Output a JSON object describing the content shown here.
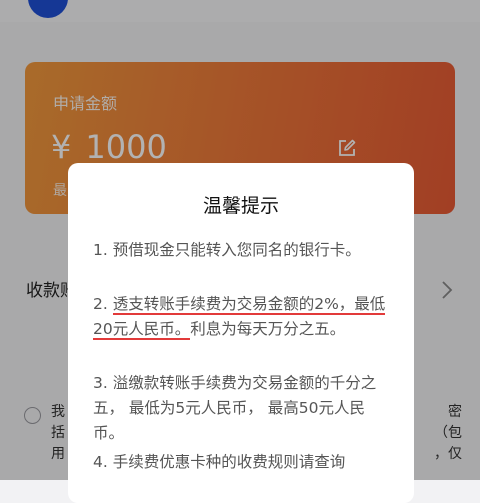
{
  "background": {
    "card": {
      "label": "申请金额",
      "currency": "¥",
      "amount": "1000",
      "edit_icon": "edit-icon",
      "partial_text": "最"
    },
    "payee_row": {
      "label": "收款账",
      "chevron": "chevron-right-icon"
    },
    "agreement": {
      "left_lines": [
        "我",
        "括",
        "用"
      ],
      "right_lines": [
        "密（包",
        "，仅"
      ]
    }
  },
  "dialog": {
    "title": "温馨提示",
    "tips": [
      {
        "prefix": "1. ",
        "text": "预借现金只能转入您同名的银行卡。"
      },
      {
        "prefix": "2. ",
        "highlight": "透支转账手续费为交易金额的2%，最低20元人民币。",
        "rest": "利息为每天万分之五。"
      },
      {
        "prefix": "3. ",
        "text": "溢缴款转账手续费为交易金额的千分之五， 最低为5元人民币， 最高50元人民币。"
      },
      {
        "prefix": "4. ",
        "text": "手续费优惠卡种的收费规则请查询"
      }
    ]
  },
  "colors": {
    "card_gradient_start": "#f29a3d",
    "card_gradient_end": "#e85a34",
    "underline": "#e23a3a",
    "overlay": "rgba(0,0,0,0.30)"
  }
}
